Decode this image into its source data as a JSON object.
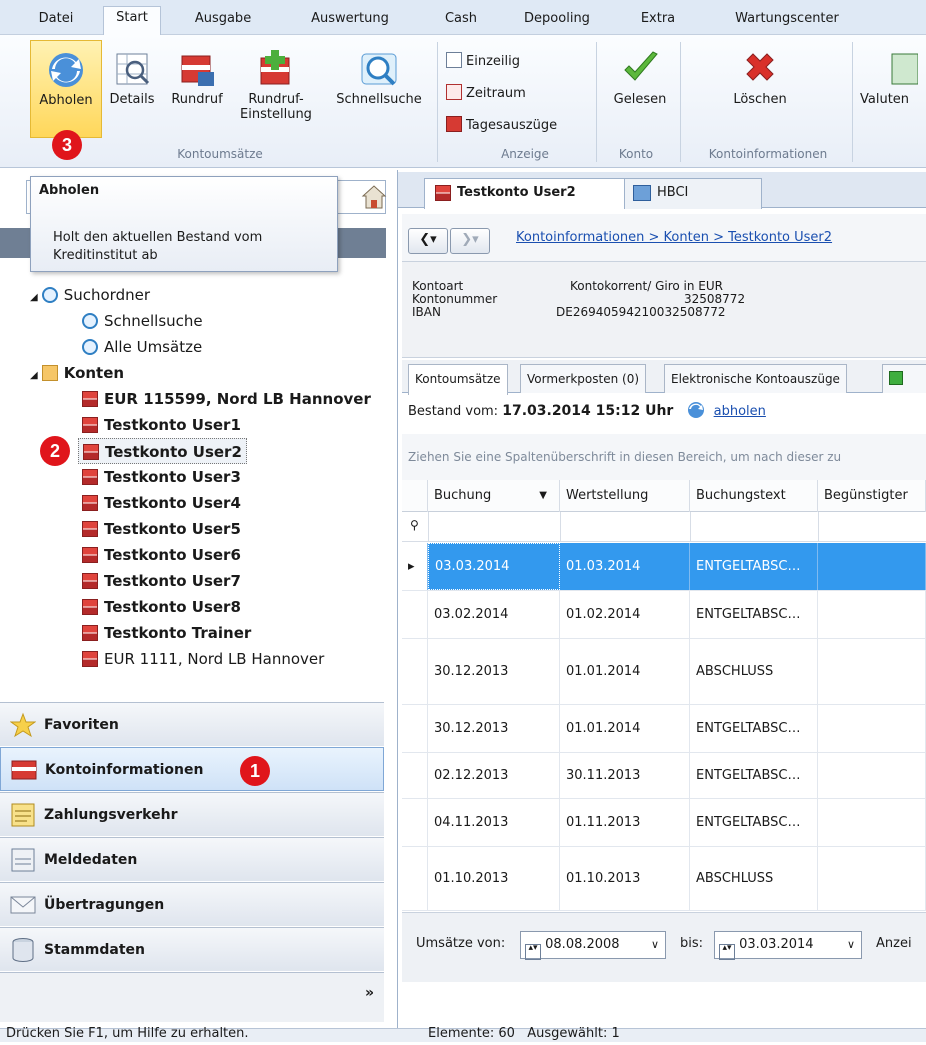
{
  "ribbon": {
    "tabs": [
      "Datei",
      "Start",
      "Ausgabe",
      "Auswertung",
      "Cash",
      "Depooling",
      "Extra",
      "Wartungscenter"
    ],
    "buttons": {
      "abholen": "Abholen",
      "details": "Details",
      "rundruf": "Rundruf",
      "rundruf_einstellung_1": "Rundruf-",
      "rundruf_einstellung_2": "Einstellung",
      "schnellsuche": "Schnellsuche",
      "einzeilig": "Einzeilig",
      "zeitraum": "Zeitraum",
      "tagesauszuege": "Tagesauszüge",
      "gelesen": "Gelesen",
      "loeschen": "Löschen",
      "valuten": "Valuten"
    },
    "groups": {
      "kontoumsaetze": "Kontoumsätze",
      "anzeige": "Anzeige",
      "konto": "Konto",
      "kontoinformationen": "Kontoinformationen"
    }
  },
  "badges": [
    "1",
    "2",
    "3"
  ],
  "tooltip": {
    "title": "Abholen",
    "text_1": "Holt den aktuellen Bestand vom",
    "text_2": "Kreditinstitut ab"
  },
  "tree": {
    "suchordner": "Suchordner",
    "schnellsuche": "Schnellsuche",
    "alle_umsaetze": "Alle Umsätze",
    "konten": "Konten",
    "accounts": [
      "EUR 115599, Nord LB Hannover",
      "Testkonto User1",
      "Testkonto User2",
      "Testkonto User3",
      "Testkonto User4",
      "Testkonto User5",
      "Testkonto User6",
      "Testkonto User7",
      "Testkonto User8",
      "Testkonto Trainer",
      "EUR 1111, Nord LB Hannover"
    ]
  },
  "nav": {
    "favoriten": "Favoriten",
    "kontoinformationen": "Kontoinformationen",
    "zahlungsverkehr": "Zahlungsverkehr",
    "meldedaten": "Meldedaten",
    "uebertragungen": "Übertragungen",
    "stammdaten": "Stammdaten",
    "more": "»"
  },
  "doc_tabs": {
    "testkonto": "Testkonto User2",
    "hbci": "HBCI"
  },
  "breadcrumb": "Kontoinformationen > Konten > Testkonto User2",
  "account_info": {
    "kontoart_label": "Kontoart",
    "kontoart_value": "Kontokorrent/ Giro in EUR",
    "kontonummer_label": "Kontonummer",
    "kontonummer_value": "32508772",
    "iban_label": "IBAN",
    "iban_value": "DE26940594210032508772"
  },
  "sub_tabs": [
    "Kontoumsätze",
    "Vormerkposten (0)",
    "Elektronische Kontoauszüge"
  ],
  "balance": {
    "label": "Bestand vom:",
    "date": "17.03.2014 15:12 Uhr",
    "link": "abholen"
  },
  "grid": {
    "hint": "Ziehen Sie eine Spaltenüberschrift in diesen Bereich, um nach dieser zu",
    "columns": [
      "Buchung",
      "Wertstellung",
      "Buchungstext",
      "Begünstigter"
    ],
    "rows": [
      [
        "03.03.2014",
        "01.03.2014",
        "ENTGELTABSC…",
        ""
      ],
      [
        "03.02.2014",
        "01.02.2014",
        "ENTGELTABSC…",
        ""
      ],
      [
        "30.12.2013",
        "01.01.2014",
        "ABSCHLUSS",
        ""
      ],
      [
        "30.12.2013",
        "01.01.2014",
        "ENTGELTABSC…",
        ""
      ],
      [
        "02.12.2013",
        "30.11.2013",
        "ENTGELTABSC…",
        ""
      ],
      [
        "04.11.2013",
        "01.11.2013",
        "ENTGELTABSC…",
        ""
      ],
      [
        "01.10.2013",
        "01.10.2013",
        "ABSCHLUSS",
        ""
      ]
    ]
  },
  "filter": {
    "von_label": "Umsätze von:",
    "von_value": "08.08.2008",
    "bis_label": "bis:",
    "bis_value": "03.03.2014",
    "anzeige_label": "Anzei"
  },
  "status": {
    "left": "Drücken Sie F1, um Hilfe zu erhalten.",
    "right": "Elemente: 60   Ausgewählt: 1"
  }
}
